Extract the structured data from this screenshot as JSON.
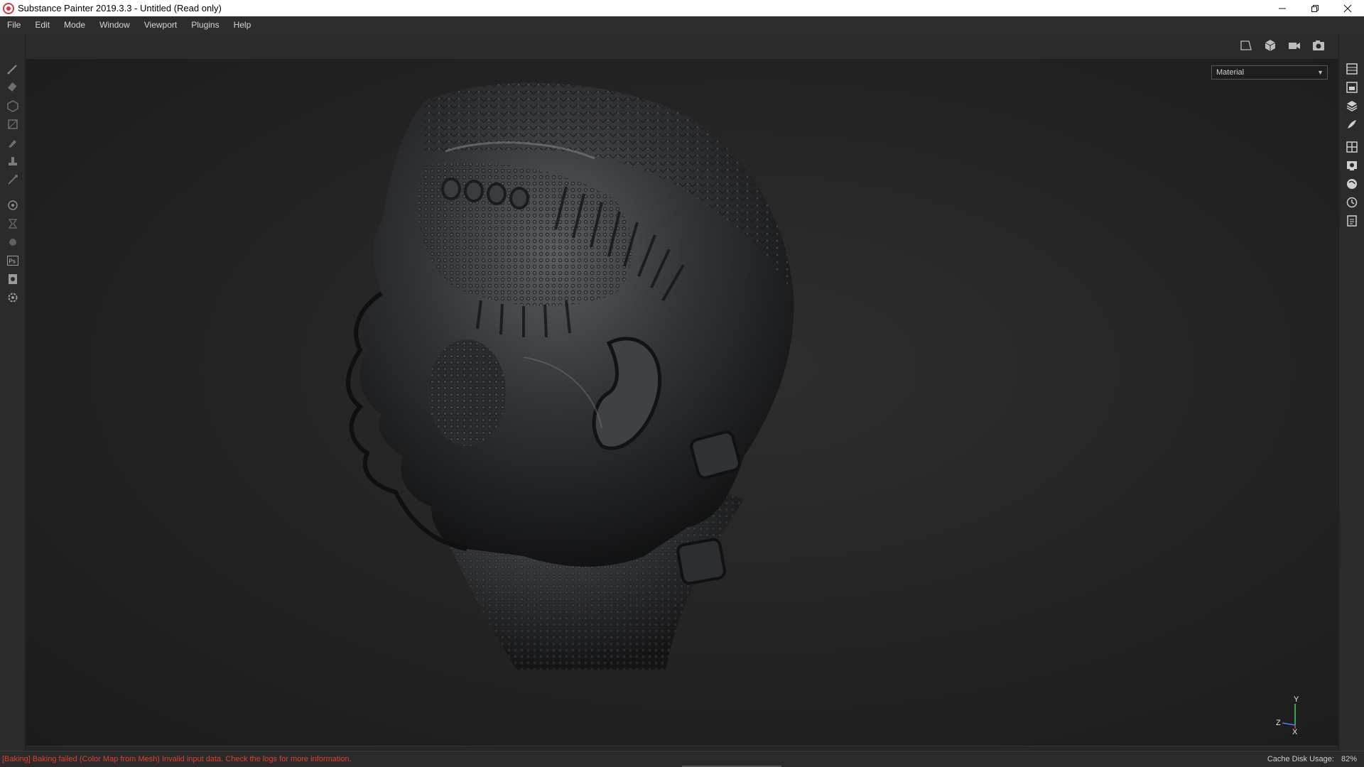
{
  "window": {
    "title": "Substance Painter 2019.3.3 - Untitled (Read only)",
    "controls": [
      "minimize-icon",
      "restore-icon",
      "close-icon"
    ]
  },
  "menu": [
    "File",
    "Edit",
    "Mode",
    "Window",
    "Viewport",
    "Plugins",
    "Help"
  ],
  "viewport": {
    "display_mode": "Material",
    "axis": {
      "y": "Y",
      "z": "Z",
      "x": "X"
    }
  },
  "left_tools": [
    "paint-brush-icon",
    "eraser-icon",
    "projection-icon",
    "polygon-fill-icon",
    "smudge-icon",
    "clone-icon",
    "color-picker-icon",
    "bake-settings-icon",
    "iray-icon",
    "physics-icon",
    "photoshop-icon",
    "export-icon",
    "settings-icon"
  ],
  "right_tools": [
    "texture-set-list-icon",
    "texture-set-settings-icon",
    "layers-icon",
    "properties-icon",
    "display-settings-icon",
    "viewer-settings-icon",
    "shader-settings-icon",
    "history-icon",
    "log-icon"
  ],
  "top_tools": [
    "view-2d-icon",
    "view-3d-icon",
    "camera-icon",
    "screenshot-icon"
  ],
  "status": {
    "message": "[Baking] Baking failed (Color Map from Mesh) Invalid input data. Check the logs for more information.",
    "cache_label": "Cache Disk Usage:",
    "cache_value": "82%"
  },
  "colors": {
    "error_text": "#e0412b",
    "panel_bg": "#2b2b2b",
    "viewport_bg": "#232323"
  }
}
